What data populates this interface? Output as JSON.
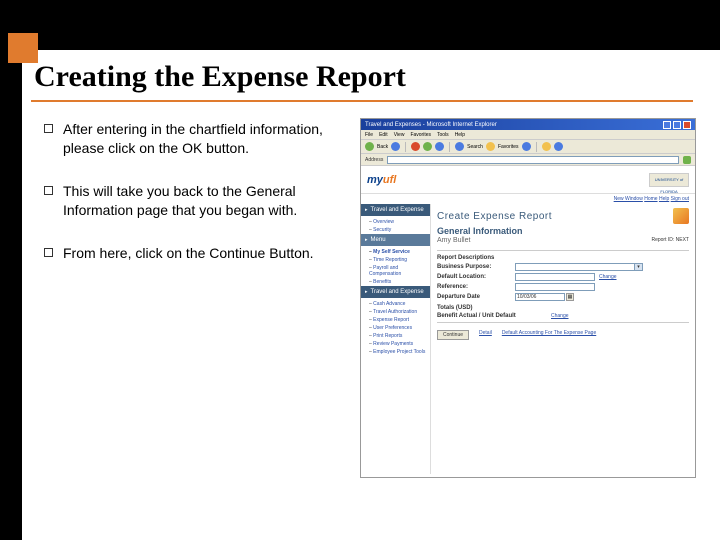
{
  "title": "Creating the Expense Report",
  "bullets": [
    "After entering in the chartfield information, please click on the OK button.",
    "This will take you back to the General Information page that you began with.",
    "From here, click on the Continue Button."
  ],
  "shot": {
    "window_title": "Travel and Expenses - Microsoft Internet Explorer",
    "menu": [
      "File",
      "Edit",
      "View",
      "Favorites",
      "Tools",
      "Help"
    ],
    "toolbar": {
      "back": "Back",
      "search": "Search",
      "favorites": "Favorites"
    },
    "addr_label": "Address",
    "logo": {
      "my": "my",
      "ufl": "ufl"
    },
    "uf_seal": "UNIVERSITY of FLORIDA",
    "toplinks": {
      "newwindow": "New Window",
      "home": "Home",
      "help": "Help",
      "signout": "Sign out"
    },
    "sidenav": {
      "title": "Travel and Expense",
      "items": [
        "Overview",
        "Security"
      ],
      "menu_title": "Menu",
      "self_service": "My Self Service",
      "self_items": [
        "Time Reporting",
        "Payroll and Compensation",
        "Benefits"
      ],
      "te_section": "Travel and Expense",
      "te_items": [
        "Cash Advance",
        "Travel Authorization",
        "Expense Report",
        "User Preferences",
        "Print Reports",
        "Review Payments",
        "Employee Project Tools"
      ]
    },
    "main": {
      "heading": "Create Expense Report",
      "subheading": "General Information",
      "who": "Amy Bullet",
      "report_id_label": "Report ID:",
      "report_id_value": "NEXT",
      "labels": {
        "report_desc": "Report Descriptions",
        "business_purpose": "Business Purpose:",
        "default_location": "Default Location:",
        "reference": "Reference:",
        "departure_date": "Departure Date",
        "date_value": "10/03/06",
        "totals": "Totals (USD)",
        "benefit": "Benefit Actual / Unit Default"
      },
      "change_link": "Change",
      "options_link": "Detail",
      "apply_link": "Default Accounting For The Expense Page",
      "continue": "Continue"
    }
  }
}
